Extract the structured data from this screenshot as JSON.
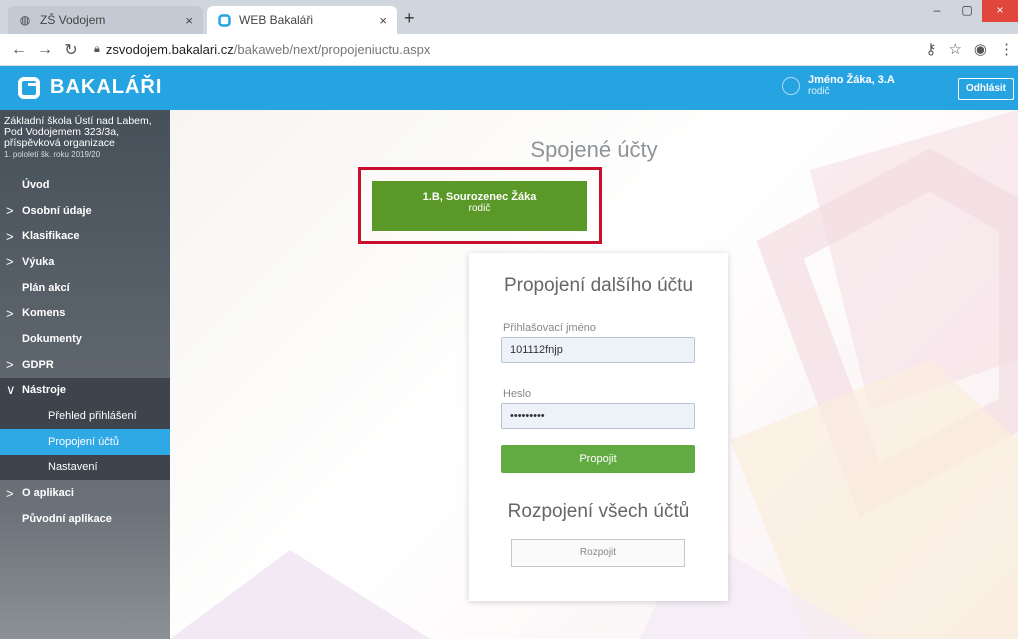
{
  "browser": {
    "tabs": [
      {
        "label": "ZŠ Vodojem",
        "close": "×"
      },
      {
        "label": "WEB Bakaláři",
        "close": "×"
      }
    ],
    "new_tab": "+",
    "window_controls": {
      "minimize": "–",
      "maximize": "▢",
      "close": "×"
    },
    "url_host": "zsvodojem.bakalari.cz",
    "url_path": "/bakaweb/next/propojeniuctu.aspx"
  },
  "header": {
    "app_name": "BAKALÁŘI",
    "user_name": "Jméno Žáka, 3.A",
    "user_role": "rodič",
    "logout_label": "Odhlásit",
    "accent": "#26a4e2"
  },
  "sidebar": {
    "school_line1": "Základní škola Ústí nad Labem,",
    "school_line2": "Pod Vodojemem 323/3a,",
    "school_line3": "příspěvková organizace",
    "term": "1. pololetí šk. roku 2019/20",
    "items": [
      {
        "label": "Úvod",
        "chevron": ""
      },
      {
        "label": "Osobní údaje",
        "chevron": ">"
      },
      {
        "label": "Klasifikace",
        "chevron": ">"
      },
      {
        "label": "Výuka",
        "chevron": ">"
      },
      {
        "label": "Plán akcí",
        "chevron": ""
      },
      {
        "label": "Komens",
        "chevron": ">"
      },
      {
        "label": "Dokumenty",
        "chevron": ""
      },
      {
        "label": "GDPR",
        "chevron": ">"
      },
      {
        "label": "Nástroje",
        "chevron": "∨"
      },
      {
        "label": "Přehled přihlášení",
        "chevron": ""
      },
      {
        "label": "Propojení účtů",
        "chevron": ""
      },
      {
        "label": "Nastavení",
        "chevron": ""
      },
      {
        "label": "O aplikaci",
        "chevron": ">"
      },
      {
        "label": "Původní aplikace",
        "chevron": ""
      }
    ]
  },
  "main": {
    "title": "Spojené účty",
    "linked_account": {
      "name": "1.B, Sourozenec Žáka",
      "role": "rodič"
    },
    "link_form": {
      "heading": "Propojení dalšího účtu",
      "username_label": "Přihlašovací jméno",
      "username_value": "101112fnjp",
      "password_label": "Heslo",
      "password_value": "•••••••••",
      "submit_label": "Propojit"
    },
    "unlink": {
      "heading": "Rozpojení všech účtů",
      "button_label": "Rozpojit"
    }
  },
  "colors": {
    "linked_account_bg": "#5a9827",
    "highlight_border": "#c8102e",
    "submit_bg": "#62ab43",
    "active_menu": "#2fa8e6"
  }
}
